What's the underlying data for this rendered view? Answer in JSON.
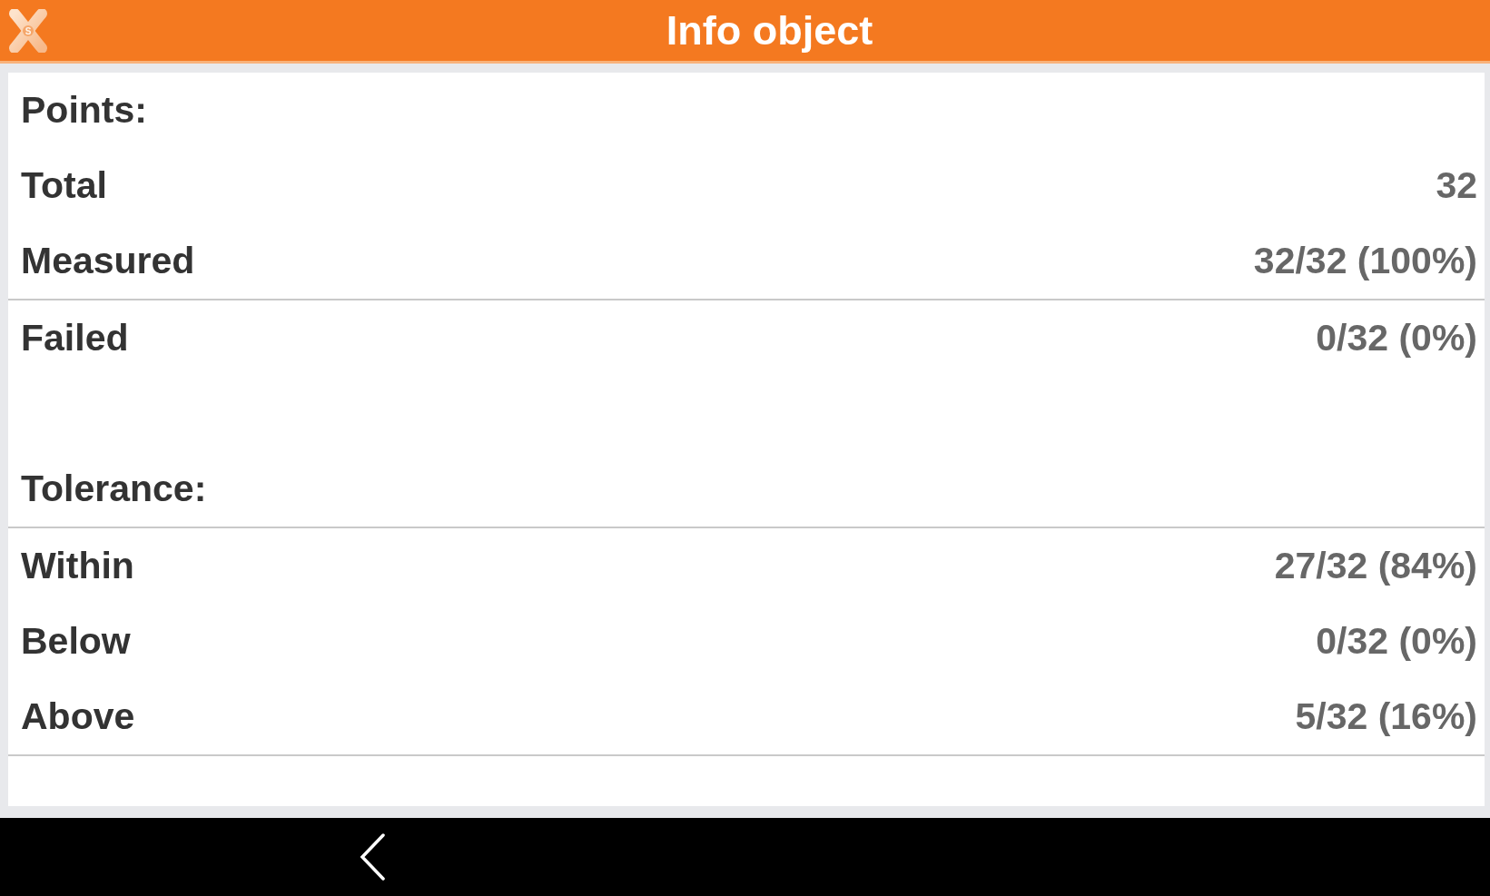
{
  "header": {
    "title": "Info object",
    "logo_letter": "S"
  },
  "rows": [
    {
      "kind": "heading",
      "label": "Points:",
      "divider": false
    },
    {
      "kind": "stat",
      "label": "Total",
      "value": "32",
      "divider": false
    },
    {
      "kind": "stat",
      "label": "Measured",
      "value": "32/32 (100%)",
      "divider": true
    },
    {
      "kind": "stat",
      "label": "Failed",
      "value": "0/32 (0%)",
      "divider": false
    },
    {
      "kind": "heading",
      "label": "Tolerance:",
      "divider": true
    },
    {
      "kind": "stat",
      "label": "Within",
      "value": "27/32 (84%)",
      "divider": false
    },
    {
      "kind": "stat",
      "label": "Below",
      "value": "0/32 (0%)",
      "divider": false
    },
    {
      "kind": "stat",
      "label": "Above",
      "value": "5/32 (16%)",
      "divider": true
    }
  ]
}
